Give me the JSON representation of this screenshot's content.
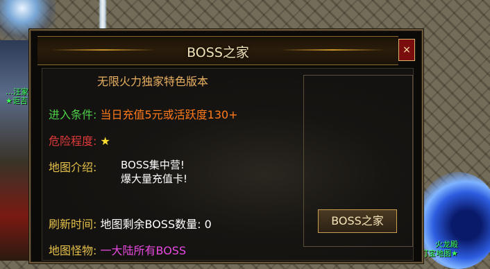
{
  "world": {
    "npc_left_line1": "…汪家",
    "npc_left_line2": "★讵吉",
    "npc_right_line1": "火龙殿",
    "npc_right_line2": "打宝地图★"
  },
  "dialog": {
    "title": "BOSS之家",
    "close_symbol": "×",
    "subtitle": "无限火力独家特色版本",
    "entry_label": "进入条件:",
    "entry_value": "当日充值5元或活跃度130+",
    "danger_label": "危险程度:",
    "danger_value": "★",
    "intro_label": "地图介绍:",
    "intro_line1": "BOSS集中营!",
    "intro_line2": "爆大量充值卡!",
    "refresh_label": "刷新时间:",
    "refresh_value": "地图剩余BOSS数量: 0",
    "monster_label": "地图怪物:",
    "monster_value": "一大陆所有BOSS",
    "button_label": "BOSS之家"
  },
  "colors": {
    "label_green": "#4ed24a",
    "label_red": "#e23a3a",
    "label_yellow": "#e6c24a",
    "value_orange": "#ff7a1a",
    "value_magenta": "#e84ae0",
    "star": "#ffe030"
  },
  "icons": {
    "close": "close-icon",
    "danger": "star-icon"
  }
}
